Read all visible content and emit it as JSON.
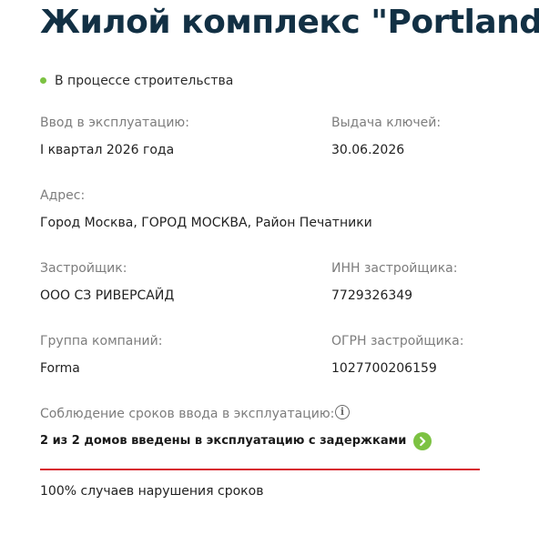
{
  "title": "Жилой комплекс \"Portland\"",
  "status": {
    "text": "В процессе строительства",
    "dot_color": "#7cc242"
  },
  "fields": {
    "commissioning": {
      "label": "Ввод в эксплуатацию:",
      "value": "I квартал 2026 года"
    },
    "keys": {
      "label": "Выдача ключей:",
      "value": "30.06.2026"
    },
    "address": {
      "label": "Адрес:",
      "value": "Город Москва, ГОРОД МОСКВА, Район Печатники"
    },
    "developer": {
      "label": "Застройщик:",
      "value": "ООО СЗ РИВЕРСАЙД"
    },
    "inn": {
      "label": "ИНН застройщика:",
      "value": "7729326349"
    },
    "group": {
      "label": "Группа компаний:",
      "value": "Forma"
    },
    "ogrn": {
      "label": "ОГРН застройщика:",
      "value": "1027700206159"
    }
  },
  "deadlines": {
    "label": "Соблюдение сроков ввода в эксплуатацию:",
    "info_icon": "info-icon",
    "summary": "2 из 2 домов введены в эксплуатацию с задержками",
    "summary_icon": "chevron-right-icon",
    "violation_ratio": 1.0,
    "violation_color": "#d7232f",
    "violation_text": "100% случаев нарушения сроков"
  }
}
